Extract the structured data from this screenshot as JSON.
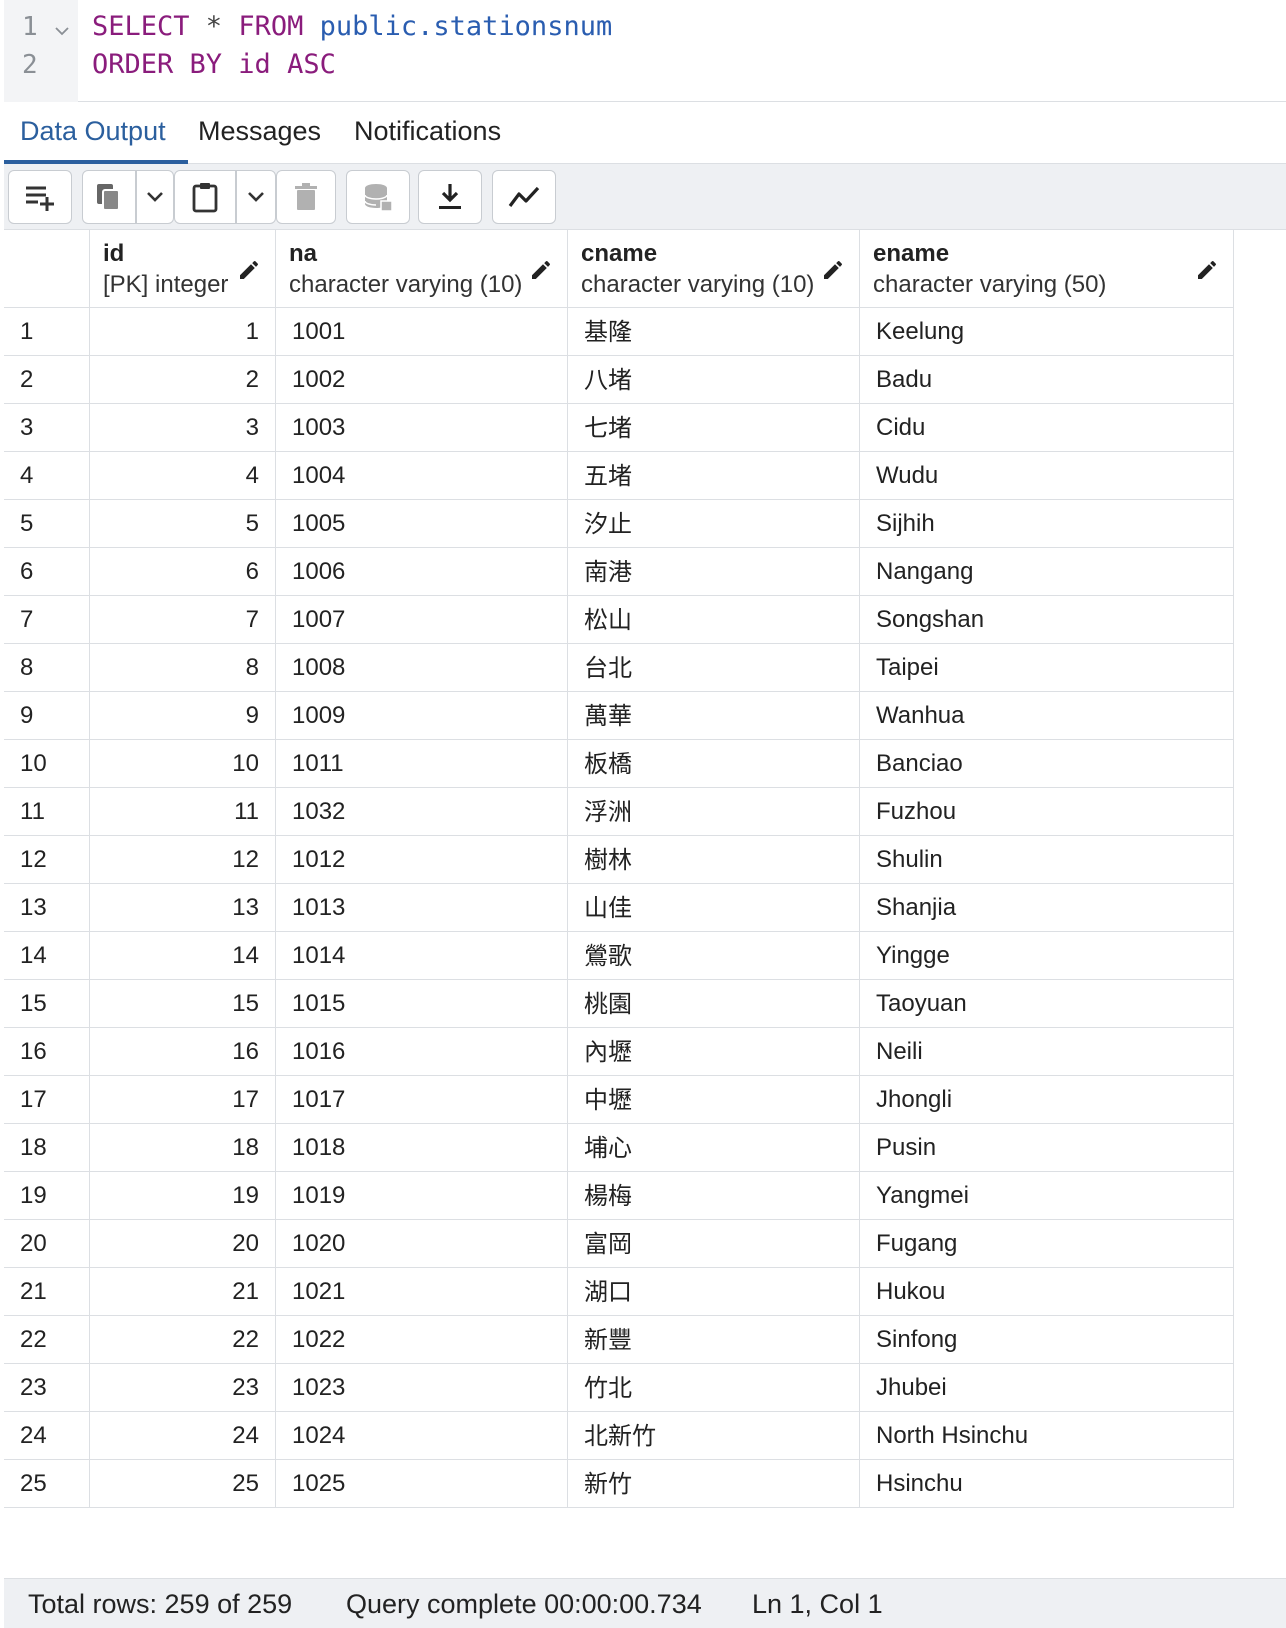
{
  "editor": {
    "lines": [
      {
        "num": "1",
        "parts": [
          {
            "t": "SELECT",
            "c": "kw"
          },
          {
            "t": " * ",
            "c": "op"
          },
          {
            "t": "FROM",
            "c": "kw"
          },
          {
            "t": " public.stationsnum",
            "c": "ident"
          }
        ]
      },
      {
        "num": "2",
        "parts": [
          {
            "t": "ORDER BY",
            "c": "kw"
          },
          {
            "t": " id ",
            "c": "kw"
          },
          {
            "t": "ASC",
            "c": "kw"
          }
        ]
      }
    ]
  },
  "tabs": {
    "data_output": "Data Output",
    "messages": "Messages",
    "notifications": "Notifications"
  },
  "toolbar": {
    "icons": [
      "add-row-icon",
      "copy-icon",
      "chevron-down-icon",
      "paste-icon",
      "chevron-down-icon",
      "delete-icon",
      "save-data-icon",
      "download-icon",
      "graph-icon"
    ]
  },
  "columns": [
    {
      "name": "id",
      "type": "[PK] integer"
    },
    {
      "name": "na",
      "type": "character varying (10)"
    },
    {
      "name": "cname",
      "type": "character varying (10)"
    },
    {
      "name": "ename",
      "type": "character varying (50)"
    }
  ],
  "rows": [
    [
      "1",
      "1",
      "1001",
      "基隆",
      "Keelung"
    ],
    [
      "2",
      "2",
      "1002",
      "八堵",
      "Badu"
    ],
    [
      "3",
      "3",
      "1003",
      "七堵",
      "Cidu"
    ],
    [
      "4",
      "4",
      "1004",
      "五堵",
      "Wudu"
    ],
    [
      "5",
      "5",
      "1005",
      "汐止",
      "Sijhih"
    ],
    [
      "6",
      "6",
      "1006",
      "南港",
      "Nangang"
    ],
    [
      "7",
      "7",
      "1007",
      "松山",
      "Songshan"
    ],
    [
      "8",
      "8",
      "1008",
      "台北",
      "Taipei"
    ],
    [
      "9",
      "9",
      "1009",
      "萬華",
      "Wanhua"
    ],
    [
      "10",
      "10",
      "1011",
      "板橋",
      "Banciao"
    ],
    [
      "11",
      "11",
      "1032",
      "浮洲",
      "Fuzhou"
    ],
    [
      "12",
      "12",
      "1012",
      "樹林",
      "Shulin"
    ],
    [
      "13",
      "13",
      "1013",
      "山佳",
      "Shanjia"
    ],
    [
      "14",
      "14",
      "1014",
      "鶯歌",
      "Yingge"
    ],
    [
      "15",
      "15",
      "1015",
      "桃園",
      "Taoyuan"
    ],
    [
      "16",
      "16",
      "1016",
      "內壢",
      "Neili"
    ],
    [
      "17",
      "17",
      "1017",
      "中壢",
      "Jhongli"
    ],
    [
      "18",
      "18",
      "1018",
      "埔心",
      "Pusin"
    ],
    [
      "19",
      "19",
      "1019",
      "楊梅",
      "Yangmei"
    ],
    [
      "20",
      "20",
      "1020",
      "富岡",
      "Fugang"
    ],
    [
      "21",
      "21",
      "1021",
      "湖口",
      "Hukou"
    ],
    [
      "22",
      "22",
      "1022",
      "新豐",
      "Sinfong"
    ],
    [
      "23",
      "23",
      "1023",
      "竹北",
      "Jhubei"
    ],
    [
      "24",
      "24",
      "1024",
      "北新竹",
      "North Hsinchu"
    ],
    [
      "25",
      "25",
      "1025",
      "新竹",
      "Hsinchu"
    ]
  ],
  "status": {
    "total_rows": "Total rows: 259 of 259",
    "query": "Query complete 00:00:00.734",
    "cursor": "Ln 1, Col 1"
  },
  "colors": {
    "accent": "#2b5f9e",
    "keyword": "#8a1c7c",
    "identifier": "#2a5db0"
  }
}
